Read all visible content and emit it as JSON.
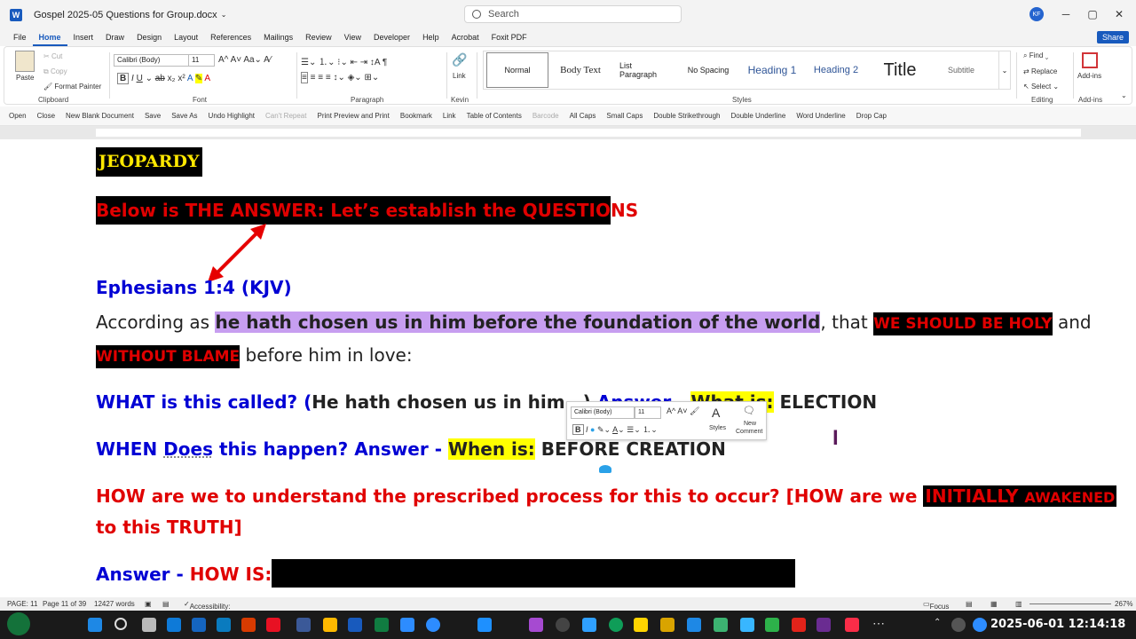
{
  "window": {
    "title": "Gospel 2025-05 Questions for Group.docx",
    "search_placeholder": "Search",
    "user_initials": "KF",
    "minimize": "─",
    "maximize": "▢",
    "close": "✕"
  },
  "menu": {
    "tabs": [
      "File",
      "Home",
      "Insert",
      "Draw",
      "Design",
      "Layout",
      "References",
      "Mailings",
      "Review",
      "View",
      "Developer",
      "Help",
      "Acrobat",
      "Foxit PDF"
    ],
    "active": "Home",
    "share": "Share"
  },
  "ribbon": {
    "clipboard": {
      "paste": "Paste",
      "cut": "Cut",
      "copy": "Copy",
      "format_painter": "Format Painter",
      "label": "Clipboard"
    },
    "font": {
      "name": "Calibri (Body)",
      "size": "11",
      "label": "Font"
    },
    "paragraph": {
      "label": "Paragraph"
    },
    "kevin": {
      "link": "Link",
      "label": "Kevin"
    },
    "styles": {
      "items": [
        "Normal",
        "Body Text",
        "List Paragraph",
        "No Spacing",
        "Heading 1",
        "Heading 2",
        "Title",
        "Subtitle"
      ],
      "label": "Styles"
    },
    "editing": {
      "find": "Find",
      "replace": "Replace",
      "select": "Select",
      "label": "Editing"
    },
    "addins": {
      "button": "Add-ins",
      "label": "Add-ins"
    }
  },
  "qat": [
    "Open",
    "Close",
    "New Blank Document",
    "Save",
    "Save As",
    "Undo Highlight",
    "Can't Repeat",
    "Print Preview and Print",
    "Bookmark",
    "Link",
    "Table of Contents",
    "Barcode",
    "All Caps",
    "Small Caps",
    "Double Strikethrough",
    "Double Underline",
    "Word Underline",
    "Drop Cap"
  ],
  "document": {
    "jeopardy": "JEOPARDY",
    "answer_banner": "Below is THE ANSWER: Let’s establish the QUESTIONS",
    "verse_ref": "Ephesians 1:4 (KJV)",
    "verse_pre": " According as ",
    "verse_hl": "he hath chosen us in him before the foundation of the world",
    "verse_mid": ", that ",
    "verse_holy": "WE SHOULD BE HOLY",
    "verse_and": " and",
    "verse_blame": "WITHOUT BLAME",
    "verse_end": " before him in love:",
    "q1_label": "WHAT is this called? (",
    "q1_body": "He hath chosen us in him…)",
    "q1_answer": " Answer - ",
    "q1_whatis": "What is:",
    "q1_value": " ELECTION",
    "q2_when": "WHEN ",
    "q2_does": "Does",
    "q2_rest": " this happen? Answer - ",
    "q2_whenis": "When is:",
    "q2_value": " BEFORE CREATION",
    "q3_text": "HOW are we to understand the prescribed process for this to occur? [HOW are we ",
    "q3_initially": "INITIALLY ",
    "q3_awakened": "AWAKENED",
    "q3_line2": "to this TRUTH]",
    "a3_answer": "Answer - ",
    "a3_howis": "HOW IS:"
  },
  "floatbar": {
    "font": "Calibri (Body)",
    "size": "11",
    "styles": "Styles",
    "new_comment_1": "New",
    "new_comment_2": "Comment"
  },
  "status": {
    "page": "PAGE: 11",
    "page_of": "Page 11 of 39",
    "words": "12427 words",
    "accessibility": "Accessibility: Investigate",
    "focus": "Focus",
    "zoom": "267%"
  },
  "taskbar": {
    "clock": "2025-06-01 12:14:18"
  }
}
